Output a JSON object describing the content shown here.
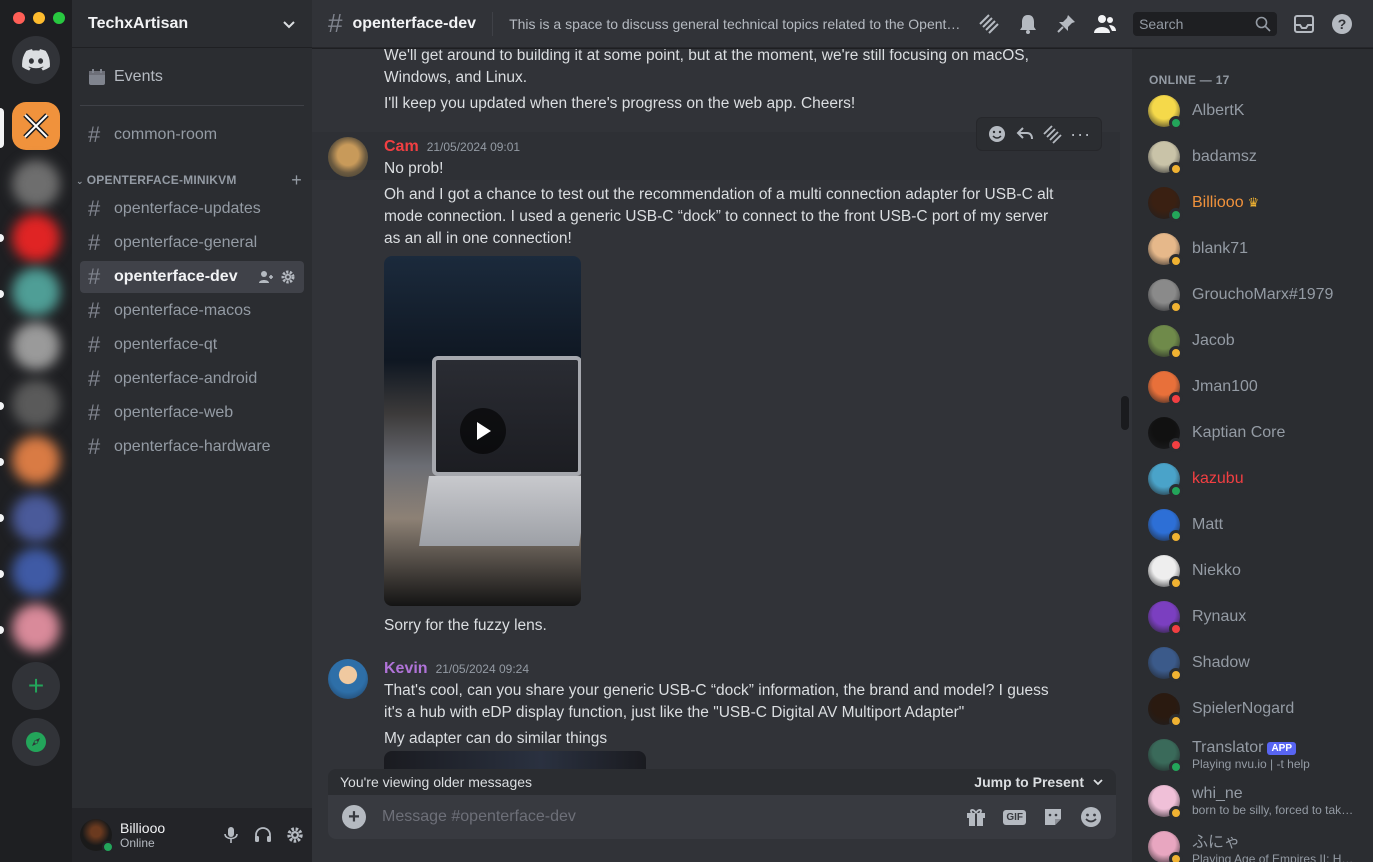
{
  "window": {
    "traffic_colors": [
      "#ff5f57",
      "#febc2e",
      "#28c840"
    ]
  },
  "servers": {
    "home_icon": "discord-logo-icon",
    "active_server_color": "#f0923c",
    "add_server_icon": "plus-icon",
    "discover_icon": "compass-icon",
    "blurred_server_colors": [
      "#6e6e6e",
      "#e02424",
      "#4f9e96",
      "#9a9a9a",
      "#5a5a5a",
      "#d97b44",
      "#4a5a9a",
      "#3f5aa5",
      "#d98a9a"
    ]
  },
  "sidebar": {
    "server_name": "TechxArtisan",
    "events_label": "Events",
    "top_channel": "common-room",
    "category": "OPENTERFACE-MINIKVM",
    "channels": [
      "openterface-updates",
      "openterface-general",
      "openterface-dev",
      "openterface-macos",
      "openterface-qt",
      "openterface-android",
      "openterface-web",
      "openterface-hardware"
    ],
    "active_channel_index": 2
  },
  "user_panel": {
    "name": "Billiooo",
    "status": "Online"
  },
  "topbar": {
    "channel": "openterface-dev",
    "topic": "This is a space to discuss general technical topics related to the Openterf...",
    "search_placeholder": "Search"
  },
  "chat": {
    "messages": [
      {
        "lines": [
          "We'll get around to building it at some point, but at the moment, we're still focusing on macOS, Windows, and Linux.",
          "I'll keep you updated when there's progress on the web app. Cheers!"
        ]
      },
      {
        "author": "Cam",
        "author_color": "#f23f42",
        "timestamp": "21/05/2024 09:01",
        "lines": [
          "No prob!",
          "Oh and I got a chance to test out the recommendation of a multi connection adapter for USB-C alt mode connection.  I used a generic USB-C “dock” to connect to the front USB-C port of my server as an all in one connection!",
          "Sorry for the fuzzy lens."
        ]
      },
      {
        "author": "Kevin",
        "author_color": "#b073d8",
        "timestamp": "21/05/2024 09:24",
        "lines": [
          "That's cool, can you share your generic USB-C “dock” information, the brand and model? I guess it's a hub with eDP display function, just like the \"USB-C Digital AV Multiport Adapter\"",
          "My adapter can do similar things"
        ]
      }
    ],
    "older_notice": "You're viewing older messages",
    "jump_label": "Jump to Present",
    "composer_placeholder": "Message #openterface-dev"
  },
  "members": {
    "header": "ONLINE — 17",
    "list": [
      {
        "name": "AlbertK",
        "status": "#23a55a",
        "avatar": "#f5d94a"
      },
      {
        "name": "badamsz",
        "status": "#f0b232",
        "avatar": "#c9c3a8"
      },
      {
        "name": "Billiooo",
        "status": "#23a55a",
        "avatar": "#3a2012",
        "color": "#f0923c",
        "crown": true
      },
      {
        "name": "blank71",
        "status": "#f0b232",
        "avatar": "#e6b88a"
      },
      {
        "name": "GrouchoMarx#1979",
        "status": "#f0b232",
        "avatar": "#8a8a8a"
      },
      {
        "name": "Jacob",
        "status": "#f0b232",
        "avatar": "#6f8a4a"
      },
      {
        "name": "Jman100",
        "status": "#f23f42",
        "avatar": "#e8703a"
      },
      {
        "name": "Kaptian Core",
        "status": "#f23f42",
        "avatar": "#111111"
      },
      {
        "name": "kazubu",
        "status": "#23a55a",
        "avatar": "#4aa3c9",
        "color": "#f23f42"
      },
      {
        "name": "Matt",
        "status": "#f0b232",
        "avatar": "#2d6fd6"
      },
      {
        "name": "Niekko",
        "status": "#f0b232",
        "avatar": "#eeeeee"
      },
      {
        "name": "Rynaux",
        "status": "#f23f42",
        "avatar": "#7b3fc0"
      },
      {
        "name": "Shadow",
        "status": "#f0b232",
        "avatar": "#3b5a8a"
      },
      {
        "name": "SpielerNogard",
        "status": "#f0b232",
        "avatar": "#2a1a10"
      },
      {
        "name": "Translator",
        "status": "#23a55a",
        "avatar": "#3a6a5a",
        "app_badge": "APP",
        "activity": "Playing nvu.io | -t help"
      },
      {
        "name": "whi_ne",
        "status": "#f0b232",
        "avatar": "#f0c0d8",
        "activity": "born to be silly, forced to take..."
      },
      {
        "name": "ふにゃ",
        "status": "#f0b232",
        "avatar": "#e8a6c0",
        "activity": "Playing Age of Empires II: HD ..."
      }
    ]
  }
}
